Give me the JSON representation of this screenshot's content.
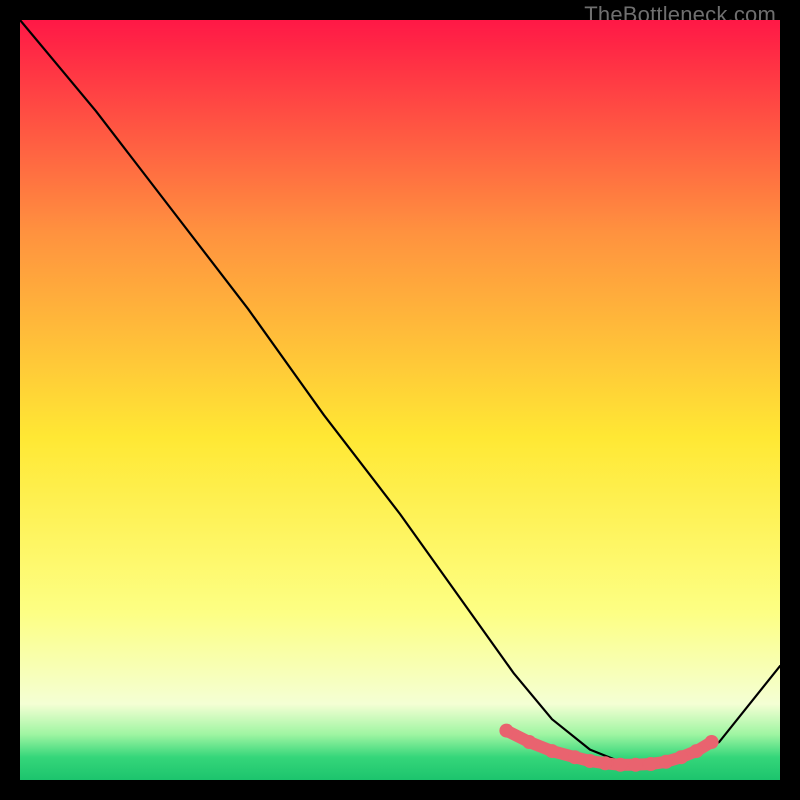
{
  "watermark": "TheBottleneck.com",
  "colors": {
    "black": "#000000",
    "curve": "#000000",
    "marker": "#e9636f",
    "grad_top": "#ff1846",
    "grad_mid_upper": "#ff923f",
    "grad_mid": "#ffe834",
    "grad_low": "#fdff84",
    "grad_pale": "#f4ffd4",
    "grad_green1": "#9ff5a2",
    "grad_green2": "#35d67a",
    "grad_green3": "#1cc46d"
  },
  "chart_data": {
    "type": "line",
    "title": "",
    "xlabel": "",
    "ylabel": "",
    "xlim": [
      0,
      100
    ],
    "ylim": [
      0,
      100
    ],
    "note": "Axes are unlabeled; values are relative percentages read from the plot area (0 = bottom/left edge, 100 = top/right edge).",
    "series": [
      {
        "name": "curve",
        "x": [
          0,
          5,
          10,
          20,
          30,
          40,
          50,
          60,
          65,
          70,
          75,
          80,
          85,
          88,
          92,
          100
        ],
        "y": [
          100,
          94,
          88,
          75,
          62,
          48,
          35,
          21,
          14,
          8,
          4,
          2,
          2,
          3,
          5,
          15
        ]
      }
    ],
    "markers": {
      "name": "highlight-points",
      "x": [
        64,
        67,
        70,
        73,
        75,
        77,
        79,
        81,
        83,
        85,
        87,
        89,
        91
      ],
      "y": [
        6.5,
        5.0,
        3.8,
        3.0,
        2.5,
        2.2,
        2.0,
        2.0,
        2.1,
        2.4,
        3.0,
        3.8,
        5.0
      ]
    }
  }
}
